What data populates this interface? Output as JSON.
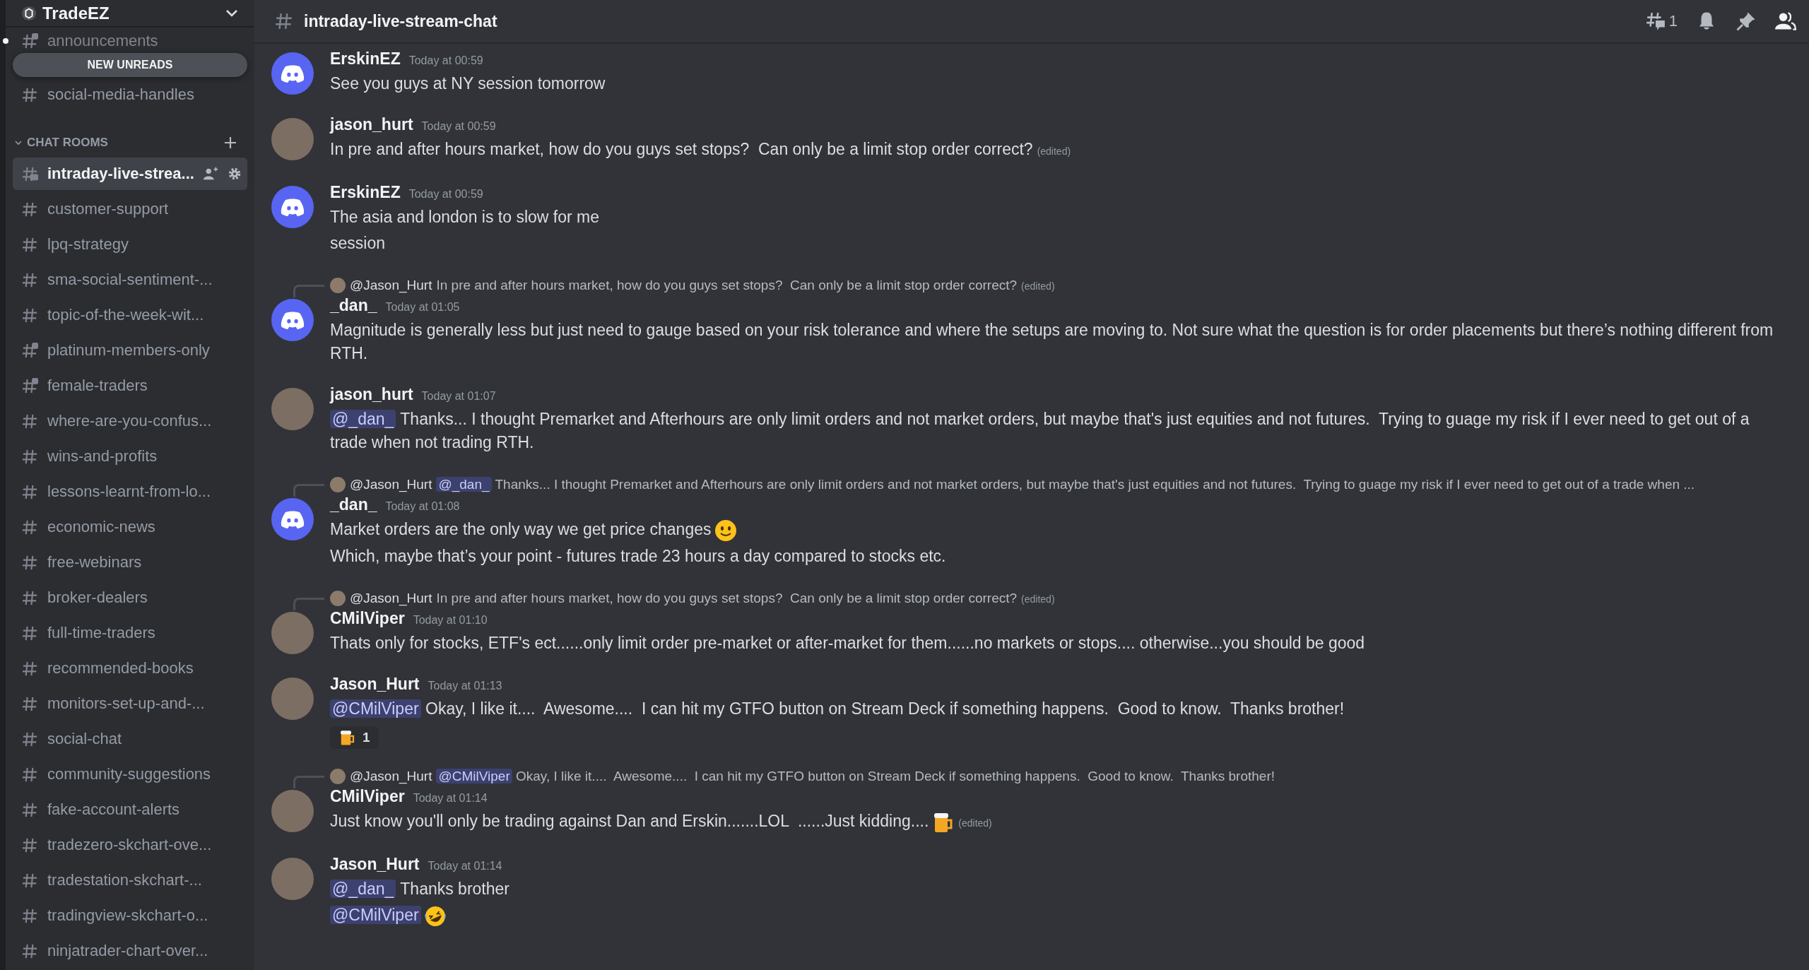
{
  "server": {
    "name": "TradeEZ"
  },
  "sidebar": {
    "new_unreads": "NEW UNREADS",
    "channels": [
      {
        "name": "announcements",
        "kind": "locked",
        "selected": false,
        "unread": true
      },
      {
        "name": "social-media-handles",
        "kind": "text",
        "selected": false,
        "unread": false
      }
    ],
    "categories": [
      {
        "name": "CHAT ROOMS",
        "expanded": true,
        "channels": [
          {
            "name": "intraday-live-strea...",
            "kind": "thread",
            "selected": true,
            "unread": false
          },
          {
            "name": "customer-support",
            "kind": "text",
            "selected": false,
            "unread": false
          },
          {
            "name": "lpq-strategy",
            "kind": "text",
            "selected": false,
            "unread": false
          },
          {
            "name": "sma-social-sentiment-...",
            "kind": "text",
            "selected": false,
            "unread": false
          },
          {
            "name": "topic-of-the-week-wit...",
            "kind": "text",
            "selected": false,
            "unread": false
          },
          {
            "name": "platinum-members-only",
            "kind": "locked",
            "selected": false,
            "unread": false
          },
          {
            "name": "female-traders",
            "kind": "locked",
            "selected": false,
            "unread": false
          },
          {
            "name": "where-are-you-confus...",
            "kind": "text",
            "selected": false,
            "unread": false
          },
          {
            "name": "wins-and-profits",
            "kind": "text",
            "selected": false,
            "unread": false
          },
          {
            "name": "lessons-learnt-from-lo...",
            "kind": "text",
            "selected": false,
            "unread": false
          },
          {
            "name": "economic-news",
            "kind": "text",
            "selected": false,
            "unread": false
          },
          {
            "name": "free-webinars",
            "kind": "text",
            "selected": false,
            "unread": false
          },
          {
            "name": "broker-dealers",
            "kind": "text",
            "selected": false,
            "unread": false
          },
          {
            "name": "full-time-traders",
            "kind": "text",
            "selected": false,
            "unread": false
          },
          {
            "name": "recommended-books",
            "kind": "text",
            "selected": false,
            "unread": false
          },
          {
            "name": "monitors-set-up-and-...",
            "kind": "text",
            "selected": false,
            "unread": false
          },
          {
            "name": "social-chat",
            "kind": "text",
            "selected": false,
            "unread": false
          },
          {
            "name": "community-suggestions",
            "kind": "text",
            "selected": false,
            "unread": false
          },
          {
            "name": "fake-account-alerts",
            "kind": "text",
            "selected": false,
            "unread": false
          },
          {
            "name": "tradezero-skchart-ove...",
            "kind": "text",
            "selected": false,
            "unread": false
          },
          {
            "name": "tradestation-skchart-...",
            "kind": "text",
            "selected": false,
            "unread": false
          },
          {
            "name": "tradingview-skchart-o...",
            "kind": "text",
            "selected": false,
            "unread": false
          },
          {
            "name": "ninjatrader-chart-over...",
            "kind": "text",
            "selected": false,
            "unread": false
          }
        ]
      }
    ]
  },
  "channel_header": {
    "name": "intraday-live-stream-chat",
    "thread_count": "1"
  },
  "messages": [
    {
      "avatar": {
        "kind": "logo"
      },
      "author": "ErskinEZ",
      "time": "Today at 00:59",
      "lines": [
        [
          {
            "kind": "text",
            "text": "See you guys at NY session tomorrow"
          }
        ]
      ]
    },
    {
      "avatar": {
        "kind": "photo"
      },
      "author": "jason_hurt",
      "time": "Today at 00:59",
      "lines": [
        [
          {
            "kind": "text",
            "text": "In pre and after hours market, how do you guys set stops?  Can only be a limit stop order correct?"
          }
        ]
      ],
      "edited": "(edited)"
    },
    {
      "avatar": {
        "kind": "logo"
      },
      "author": "ErskinEZ",
      "time": "Today at 00:59",
      "lines": [
        [
          {
            "kind": "text",
            "text": "The asia and london is to slow for me"
          }
        ],
        [
          {
            "kind": "text",
            "text": "session"
          }
        ]
      ]
    },
    {
      "reply": {
        "author": "@Jason_Hurt",
        "segments": [
          {
            "kind": "text",
            "text": "In pre and after hours market, how do you guys set stops?  Can only be a limit stop order correct?"
          }
        ],
        "edited": "(edited)"
      },
      "avatar": {
        "kind": "logo"
      },
      "author": "_dan_",
      "time": "Today at 01:05",
      "lines": [
        [
          {
            "kind": "text",
            "text": "Magnitude is generally less but just need to gauge based on your risk tolerance and where the setups are moving to. Not sure what the question is for order placements but there’s nothing different from RTH."
          }
        ]
      ]
    },
    {
      "avatar": {
        "kind": "photo"
      },
      "author": "jason_hurt",
      "time": "Today at 01:07",
      "lines": [
        [
          {
            "kind": "mention",
            "text": "@_dan_"
          },
          {
            "kind": "text",
            "text": " Thanks... I thought Premarket and Afterhours are only limit orders and not market orders, but maybe that's just equities and not futures.  Trying to guage my risk if I ever need to get out of a trade when not trading RTH."
          }
        ]
      ]
    },
    {
      "reply": {
        "author": "@Jason_Hurt",
        "segments": [
          {
            "kind": "mention",
            "text": "@_dan_"
          },
          {
            "kind": "text",
            "text": " Thanks... I thought Premarket and Afterhours are only limit orders and not market orders, but maybe that's just equities and not futures.  Trying to guage my risk if I ever need to get out of a trade when ..."
          }
        ]
      },
      "avatar": {
        "kind": "logo"
      },
      "author": "_dan_",
      "time": "Today at 01:08",
      "lines": [
        [
          {
            "kind": "text",
            "text": "Market orders are the only way we get price changes"
          },
          {
            "kind": "smiley"
          }
        ],
        [
          {
            "kind": "text",
            "text": "Which, maybe that’s your point - futures trade 23 hours a day compared to stocks etc."
          }
        ]
      ]
    },
    {
      "reply": {
        "author": "@Jason_Hurt",
        "segments": [
          {
            "kind": "text",
            "text": "In pre and after hours market, how do you guys set stops?  Can only be a limit stop order correct?"
          }
        ],
        "edited": "(edited)"
      },
      "avatar": {
        "kind": "photo"
      },
      "author": "CMilViper",
      "time": "Today at 01:10",
      "lines": [
        [
          {
            "kind": "text",
            "text": "Thats only for stocks, ETF's ect......only limit order pre-market or after-market for them......no markets or stops.... otherwise...you should be good"
          }
        ]
      ]
    },
    {
      "avatar": {
        "kind": "photo"
      },
      "author": "Jason_Hurt",
      "time": "Today at 01:13",
      "lines": [
        [
          {
            "kind": "mention",
            "text": "@CMilViper"
          },
          {
            "kind": "text",
            "text": " Okay, I like it....  Awesome....  I can hit my GTFO button on Stream Deck if something happens.  Good to know.  Thanks brother!"
          }
        ]
      ],
      "reaction": {
        "kind": "beer",
        "count": "1"
      }
    },
    {
      "reply": {
        "author": "@Jason_Hurt",
        "segments": [
          {
            "kind": "mention",
            "text": "@CMilViper"
          },
          {
            "kind": "text",
            "text": " Okay, I like it....  Awesome....  I can hit my GTFO button on Stream Deck if something happens.  Good to know.  Thanks brother!"
          }
        ]
      },
      "avatar": {
        "kind": "photo"
      },
      "author": "CMilViper",
      "time": "Today at 01:14",
      "lines": [
        [
          {
            "kind": "text",
            "text": "Just know you'll only be trading against Dan and Erskin.......LOL  ......Just kidding...."
          },
          {
            "kind": "beer"
          }
        ]
      ],
      "edited": "(edited)"
    },
    {
      "avatar": {
        "kind": "photo"
      },
      "author": "Jason_Hurt",
      "time": "Today at 01:14",
      "lines": [
        [
          {
            "kind": "mention",
            "text": "@_dan_"
          },
          {
            "kind": "text",
            "text": " Thanks brother"
          }
        ],
        [
          {
            "kind": "mention",
            "text": "@CMilViper"
          },
          {
            "kind": "laughing"
          }
        ]
      ]
    }
  ]
}
